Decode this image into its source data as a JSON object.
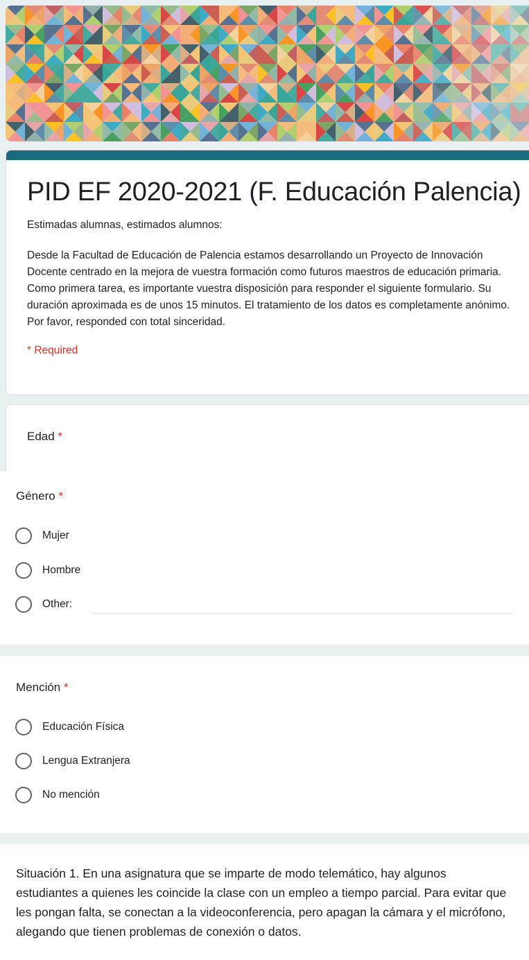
{
  "form": {
    "title": "PID EF 2020-2021 (F. Educación Palencia)",
    "description": {
      "greeting": "Estimadas alumnas, estimados alumnos:",
      "paragraph_1": "Desde la Facultad de Educación de Palencia estamos desarrollando un Proyecto de Innovación Docente centrado en la mejora de vuestra formación como futuros maestros de educación primaria.",
      "paragraph_2": "Como primera tarea, es importante vuestra disposición para responder el siguiente formulario. Su duración aproximada es de unos 15 minutos. El tratamiento de los datos es completamente anónimo. Por favor, responded con total sinceridad."
    },
    "required_note": "* Required",
    "accent_color": "#1a6b80",
    "required_color": "#d93025"
  },
  "questions": {
    "edad": {
      "title": "Edad",
      "required_mark": "*"
    },
    "genero": {
      "title": "Género",
      "required_mark": "*",
      "options": [
        "Mujer",
        "Hombre",
        "Other:"
      ]
    },
    "mencion": {
      "title": "Mención",
      "required_mark": "*",
      "options": [
        "Educación Física",
        "Lengua Extranjera",
        "No mención"
      ]
    },
    "situacion_1": {
      "text": "Situación 1. En una asignatura que se imparte de modo telemático, hay algunos estudiantes a quienes les coincide la clase con un empleo a tiempo parcial. Para evitar que les pongan falta, se conectan a la videoconferencia, pero apagan la cámara y el micrófono, alegando que tienen problemas de conexión o datos."
    }
  }
}
